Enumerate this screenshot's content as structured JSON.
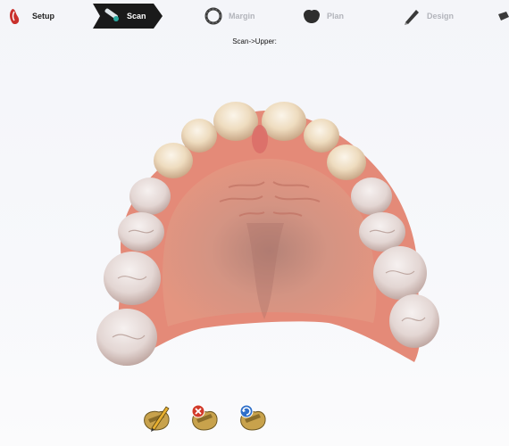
{
  "workflow": {
    "steps": [
      {
        "label": "Setup",
        "icon": "jaw-setup-icon",
        "state": "done"
      },
      {
        "label": "Scan",
        "icon": "scanner-wand-icon",
        "state": "active"
      },
      {
        "label": "Margin",
        "icon": "margin-ring-icon",
        "state": "upcoming"
      },
      {
        "label": "Plan",
        "icon": "crown-plan-icon",
        "state": "upcoming"
      },
      {
        "label": "Design",
        "icon": "design-pen-icon",
        "state": "upcoming"
      }
    ],
    "active_color": "#1a1a1a"
  },
  "breadcrumb": "Scan->Upper:",
  "viewport": {
    "model": "upper-arch-scan-model"
  },
  "tools": [
    {
      "name": "edit-scan-button",
      "icon": "model-pencil-icon",
      "badge_color": "#e8b030"
    },
    {
      "name": "delete-scan-button",
      "icon": "model-delete-icon",
      "badge_color": "#d23a2a"
    },
    {
      "name": "rescan-button",
      "icon": "model-refresh-icon",
      "badge_color": "#2f6fc9"
    }
  ]
}
